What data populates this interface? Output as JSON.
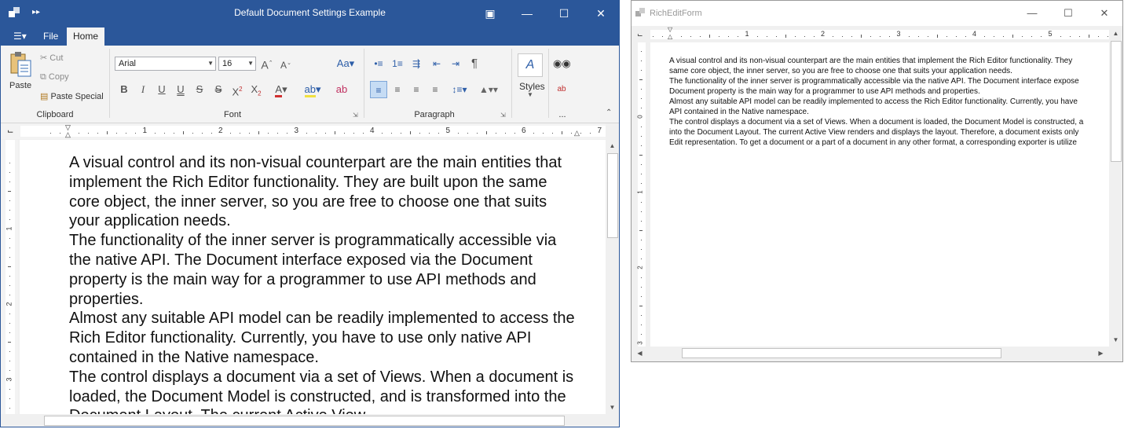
{
  "window1": {
    "title": "Default Document Settings Example",
    "tabs": [
      "File",
      "Home"
    ],
    "active_tab": "Home",
    "clipboard": {
      "paste": "Paste",
      "cut": "Cut",
      "copy": "Copy",
      "paste_special": "Paste Special",
      "caption": "Clipboard"
    },
    "font": {
      "family": "Arial",
      "size": "16",
      "caption": "Font"
    },
    "paragraph": {
      "caption": "Paragraph"
    },
    "styles": {
      "label": "Styles"
    },
    "editing_caption": "...",
    "ruler_numbers": [
      "1",
      "2",
      "3",
      "4",
      "5",
      "6",
      "7"
    ],
    "vruler_numbers": [
      "1",
      "2",
      "3"
    ],
    "paragraphs": [
      "A visual control and its non-visual counterpart are the main entities that implement the Rich Editor functionality. They are built upon the same core object, the inner server, so you are free to choose one that suits your application needs.",
      "The functionality of the inner server is programmatically accessible via the native API. The Document interface exposed via the Document property is the main way for a programmer to use API methods and properties.",
      "Almost any suitable API model can be readily implemented to access the Rich Editor functionality. Currently, you have to use only native API contained in the Native namespace.",
      "The control displays a document via a set of Views. When a document is loaded, the Document Model is constructed, and is transformed into the Document Layout. The current Active View"
    ]
  },
  "window2": {
    "title": "RichEditForm",
    "ruler_numbers": [
      "1",
      "2",
      "3",
      "4",
      "5"
    ],
    "vruler_numbers": [
      "0",
      "1",
      "2",
      "3"
    ],
    "lines": [
      "A visual control and its non-visual counterpart are the main entities that implement the Rich Editor functionality. They",
      "same core object, the inner server, so you are free to choose one that suits your application needs.",
      "The functionality of the inner server is programmatically accessible via the native API. The Document interface expose",
      "Document property is the main way for a programmer to use API methods and properties.",
      "Almost any suitable API model can be readily implemented to access the Rich Editor functionality. Currently, you have",
      "API contained in the Native namespace.",
      "The control displays a document via a set of Views. When a document is loaded, the Document Model is constructed, a",
      "into the Document Layout. The current Active View renders and displays the layout. Therefore, a document exists only",
      "Edit representation. To get a document or a part of a document in any other format, a corresponding exporter is utilize"
    ]
  },
  "colors": {
    "titlebar": "#2b579a",
    "ribbon": "#f3f3f3",
    "selected_button": "#c6dcf4"
  }
}
